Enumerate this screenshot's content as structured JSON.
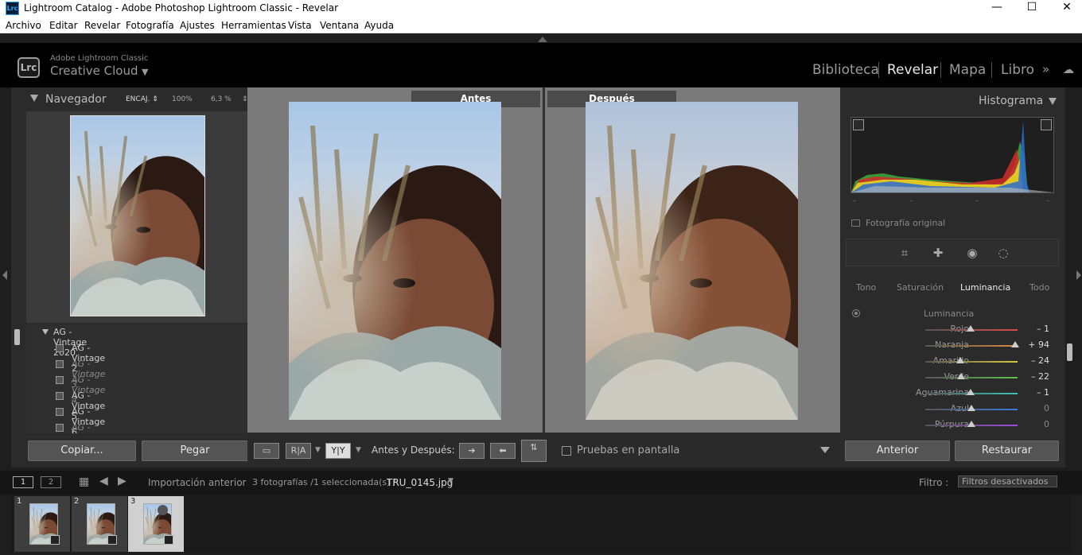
{
  "window": {
    "app_icon": "Lrc",
    "title": "Lightroom Catalog - Adobe Photoshop Lightroom Classic - Revelar",
    "controls": {
      "minimize": "—",
      "maximize": "☐",
      "close": "✕"
    }
  },
  "menu": [
    "Archivo",
    "Editar",
    "Revelar",
    "Fotografía",
    "Ajustes",
    "Herramientas",
    "Vista",
    "Ventana",
    "Ayuda"
  ],
  "identity": {
    "icon": "Lrc",
    "small": "Adobe Lightroom Classic",
    "big": "Creative Cloud",
    "caret": "▼"
  },
  "modules": [
    "Biblioteca",
    "Revelar",
    "Mapa",
    "Libro"
  ],
  "active_module": "Revelar",
  "module_more": "»",
  "navigator": {
    "title": "Navegador",
    "zooms": [
      "ENCAJ. ⇕",
      "100%",
      "6,3 %",
      "⇕"
    ]
  },
  "presets": {
    "group": "AG - Vintage 2020",
    "items": [
      {
        "label": "AG - Vintage 2",
        "dim": false
      },
      {
        "label": "AG - Vintage 3",
        "dim": true
      },
      {
        "label": "AG - Vintage 4",
        "dim": true
      },
      {
        "label": "AG - Vintage 5",
        "dim": false
      },
      {
        "label": "AG - Vintage 6",
        "dim": false
      },
      {
        "label": "AG - VintageI",
        "dim": true
      }
    ]
  },
  "left_buttons": {
    "copy": "Copiar...",
    "paste": "Pegar"
  },
  "compare": {
    "before": "Antes",
    "after": "Después"
  },
  "toolbar": {
    "ra": "R|A",
    "yy": "Y|Y",
    "before_after_label": "Antes y Después:",
    "soft_proof": "Pruebas en pantalla"
  },
  "histogram": {
    "title": "Histograma",
    "values": [
      "–",
      "–",
      "–",
      "–"
    ],
    "original_label": "Fotografía original"
  },
  "hsl": {
    "tabs": [
      "Tono",
      "Saturación",
      "Luminancia",
      "Todo"
    ],
    "active_tab": "Luminancia",
    "section": "Luminancia",
    "rows": [
      {
        "label": "Rojo",
        "value": "– 1",
        "pos": 49,
        "color": "#d94a4a"
      },
      {
        "label": "Naranja",
        "value": "+ 94",
        "pos": 97,
        "color": "#d98a3a"
      },
      {
        "label": "Amarillo",
        "value": "– 24",
        "pos": 38,
        "color": "#d9c93a"
      },
      {
        "label": "Verde",
        "value": "– 22",
        "pos": 39,
        "color": "#5fc24a"
      },
      {
        "label": "Aguamarina",
        "value": "– 1",
        "pos": 49,
        "color": "#3ac2b2"
      },
      {
        "label": "Azul",
        "value": "0",
        "pos": 50,
        "color": "#3a7ad9"
      },
      {
        "label": "Púrpura",
        "value": "0",
        "pos": 50,
        "color": "#9a4ad9"
      }
    ]
  },
  "right_buttons": {
    "previous": "Anterior",
    "reset": "Restaurar"
  },
  "filmbar": {
    "screen1": "1",
    "screen2": "2",
    "source": "Importación anterior",
    "count": "3 fotografías /1 seleccionada(s) /",
    "filename": "TRU_0145.jpg",
    "filter_label": "Filtro :",
    "filter_value": "Filtros desactivados"
  },
  "filmstrip": [
    {
      "num": "1"
    },
    {
      "num": "2"
    },
    {
      "num": "3"
    }
  ]
}
